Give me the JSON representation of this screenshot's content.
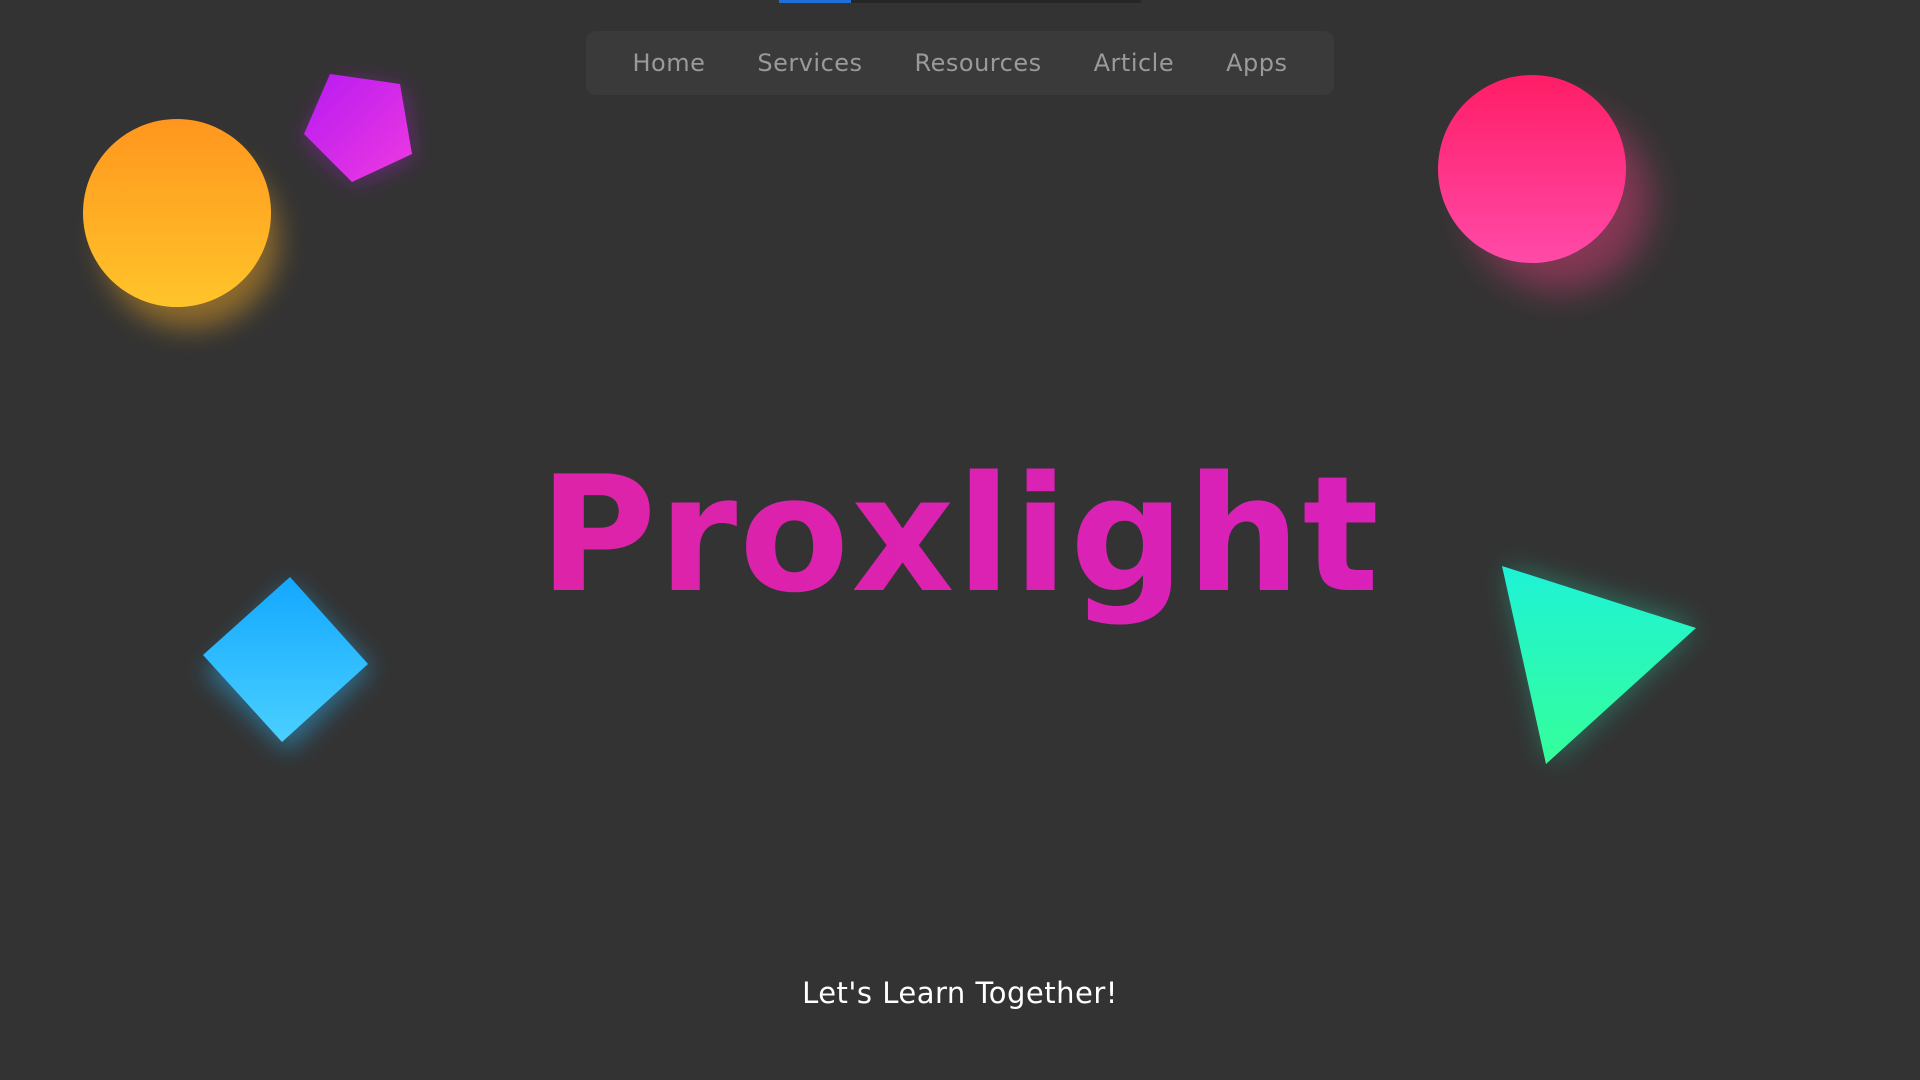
{
  "nav": {
    "progress_fraction": 0.2,
    "items": [
      {
        "label": "Home"
      },
      {
        "label": "Services"
      },
      {
        "label": "Resources"
      },
      {
        "label": "Article"
      },
      {
        "label": "Apps"
      }
    ]
  },
  "hero": {
    "title": "Proxlight",
    "tagline": "Let's Learn Together!"
  },
  "colors": {
    "background": "#333333",
    "nav_background": "#3a3a3a",
    "nav_text": "#9a9a9a",
    "title_gradient_start": "#e0259a",
    "title_gradient_end": "#d61fc8",
    "progress_accent": "#1e6fd9",
    "orange_circle": "#ffa41f",
    "purple_pentagon": "#c51af0",
    "pink_circle": "#ff2e79",
    "blue_diamond": "#25b8ff",
    "green_triangle": "#1fffc4"
  },
  "decorations": [
    {
      "name": "orange-circle",
      "shape": "circle"
    },
    {
      "name": "purple-pentagon",
      "shape": "pentagon"
    },
    {
      "name": "pink-circle",
      "shape": "circle"
    },
    {
      "name": "blue-diamond",
      "shape": "diamond"
    },
    {
      "name": "green-triangle",
      "shape": "triangle"
    }
  ]
}
